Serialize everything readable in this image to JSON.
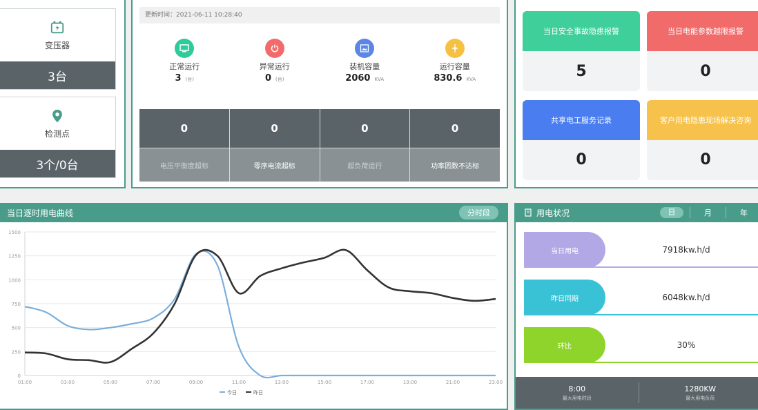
{
  "devices": {
    "transformer": {
      "label": "变压器",
      "value": "3台"
    },
    "monitor": {
      "label": "检测点",
      "value": "3个/0台"
    }
  },
  "status": {
    "updated": "更新时间：2021-06-11 10:28:40",
    "stats": [
      {
        "label": "正常运行",
        "value": "3",
        "unit": "(台)",
        "color": "#2ecc9a"
      },
      {
        "label": "异常运行",
        "value": "0",
        "unit": "(台)",
        "color": "#f26b6b"
      },
      {
        "label": "装机容量",
        "value": "2060",
        "unit": "KVA",
        "color": "#5b86e5"
      },
      {
        "label": "运行容量",
        "value": "830.6",
        "unit": "KVA",
        "color": "#f6c143"
      }
    ],
    "grid": [
      {
        "value": "0",
        "label": "电压平衡度超标"
      },
      {
        "value": "0",
        "label": "零序电流超标"
      },
      {
        "value": "0",
        "label": "超负荷运行"
      },
      {
        "value": "0",
        "label": "功率因数不达标"
      }
    ]
  },
  "alerts": [
    {
      "label": "当日安全事故隐患报警",
      "value": "5",
      "color": "#3ecf9a"
    },
    {
      "label": "当日电能参数越限报警",
      "value": "0",
      "color": "#f26b6b"
    },
    {
      "label": "共享电工服务记录",
      "value": "0",
      "color": "#4a7ef0"
    },
    {
      "label": "客户用电隐患现场解决咨询",
      "value": "0",
      "color": "#f7c24b"
    }
  ],
  "chart_panel": {
    "title": "当日逐时用电曲线",
    "button": "分时段"
  },
  "chart_data": {
    "type": "line",
    "x": [
      "01:00",
      "02:00",
      "03:00",
      "04:00",
      "05:00",
      "06:00",
      "07:00",
      "08:00",
      "09:00",
      "10:00",
      "11:00",
      "12:00",
      "13:00",
      "14:00",
      "15:00",
      "16:00",
      "17:00",
      "18:00",
      "19:00",
      "20:00",
      "21:00",
      "22:00",
      "23:00"
    ],
    "xticks": [
      "01:00",
      "03:00",
      "05:00",
      "07:00",
      "09:00",
      "11:00",
      "13:00",
      "15:00",
      "17:00",
      "19:00",
      "21:00",
      "23:00"
    ],
    "yticks": [
      "0",
      "250",
      "500",
      "750",
      "1000",
      "1250",
      "1500"
    ],
    "ylim": [
      0,
      1500
    ],
    "series": [
      {
        "name": "今日",
        "color": "#7aaedc",
        "values": [
          720,
          660,
          520,
          480,
          500,
          540,
          600,
          800,
          1270,
          1150,
          300,
          0,
          0,
          0,
          0,
          0,
          0,
          0,
          0,
          0,
          0,
          0,
          0
        ]
      },
      {
        "name": "昨日",
        "color": "#333333",
        "values": [
          240,
          230,
          170,
          160,
          140,
          280,
          440,
          750,
          1260,
          1250,
          860,
          1040,
          1120,
          1180,
          1230,
          1310,
          1100,
          920,
          880,
          860,
          810,
          780,
          800
        ]
      }
    ]
  },
  "usage": {
    "title": "用电状况",
    "tabs": [
      "日",
      "月",
      "年"
    ],
    "rows": [
      {
        "label": "当日用电",
        "value": "7918kw.h/d",
        "color": "#b2a8e6",
        "line": "#b2a8e6"
      },
      {
        "label": "昨日同期",
        "value": "6048kw.h/d",
        "color": "#39c2d6",
        "line": "#39c2d6"
      },
      {
        "label": "环比",
        "value": "30%",
        "color": "#8fd42a",
        "line": "#8fd42a"
      }
    ],
    "foot": [
      {
        "value": "8:00",
        "label": "最大用电时段"
      },
      {
        "value": "1280KW",
        "label": "最大用电负荷"
      }
    ]
  }
}
